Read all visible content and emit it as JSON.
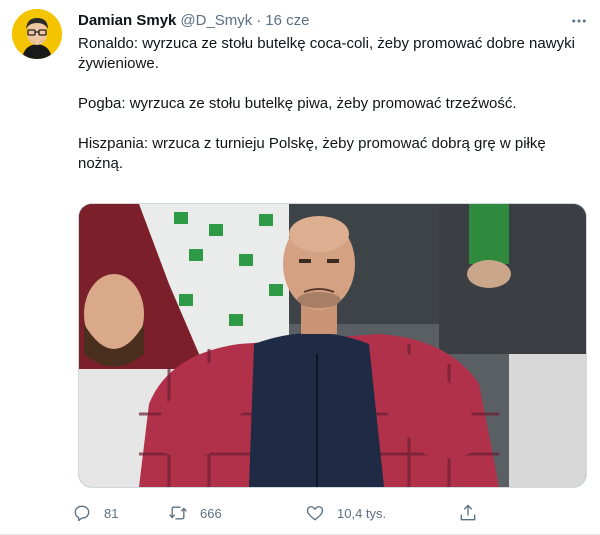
{
  "tweet": {
    "author_name": "Damian Smyk",
    "author_handle": "@D_Smyk",
    "separator": "·",
    "date": "16 cze",
    "paragraphs": [
      "Ronaldo: wyrzuca ze stołu butelkę coca-coli, żeby promować dobre nawyki żywieniowe.",
      "Pogba: wyrzuca ze stołu butelkę piwa, żeby promować trzeźwość.",
      "Hiszpania: wrzuca z turnieju Polskę, żeby promować dobrą grę w piłkę nożną."
    ]
  },
  "actions": {
    "replies": "81",
    "retweets": "666",
    "likes": "10,4 tys."
  },
  "icons": {
    "more": "more-horizontal-icon",
    "reply": "reply-icon",
    "retweet": "retweet-icon",
    "like": "heart-icon",
    "share": "share-icon"
  },
  "colors": {
    "text": "#0f1419",
    "muted": "#5b7083",
    "avatar_bg": "#f5c400"
  }
}
